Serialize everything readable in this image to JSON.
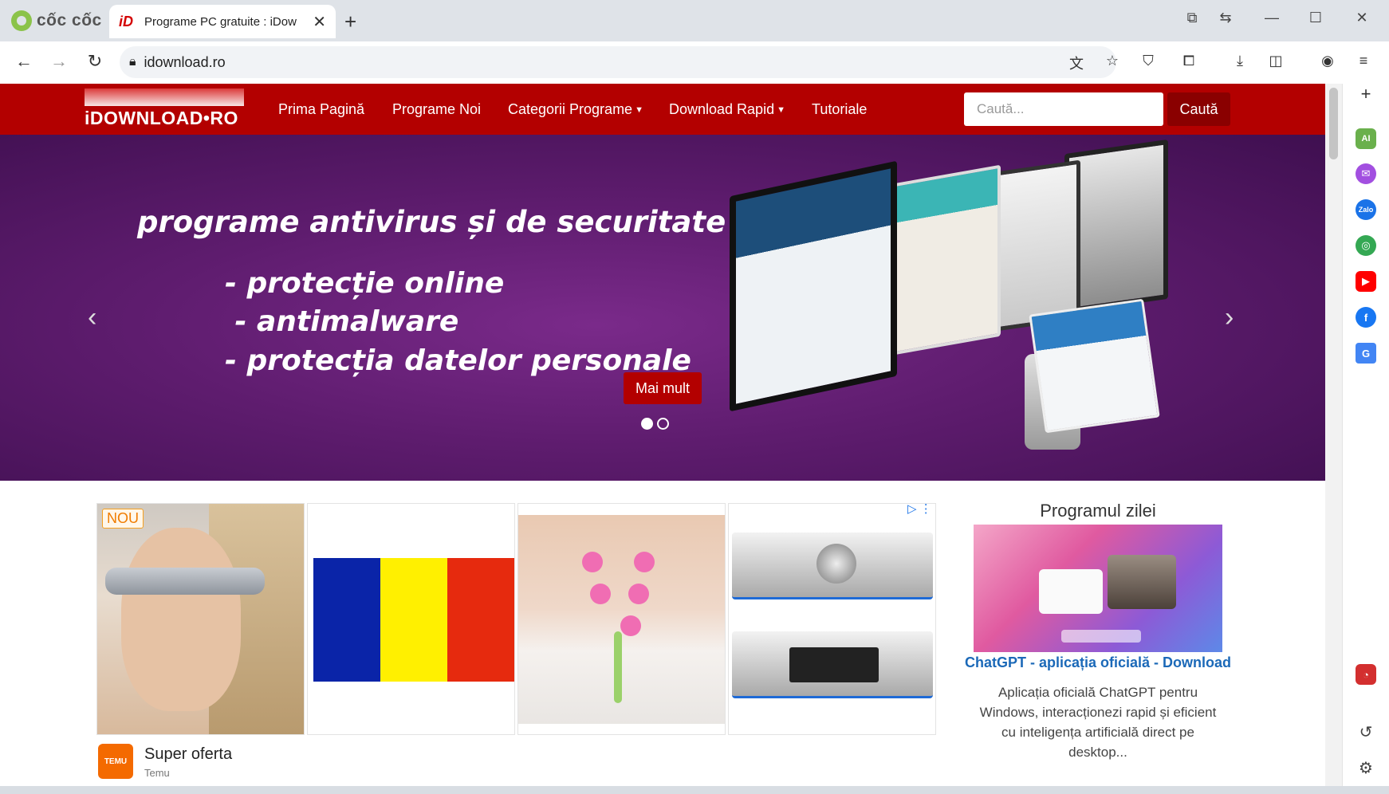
{
  "browser": {
    "brand": "cốc cốc",
    "tab_title": "Programe PC gratuite : iDow",
    "tab_favicon": "iD",
    "url": "idownload.ro",
    "accent": "#8bc34a"
  },
  "site": {
    "logo_text": "iDOWNLOAD•RO",
    "menu": {
      "home": "Prima Pagină",
      "new": "Programe Noi",
      "categories": "Categorii Programe",
      "rapid": "Download Rapid",
      "tutorials": "Tutoriale"
    },
    "search": {
      "placeholder": "Caută...",
      "button": "Caută"
    },
    "colors": {
      "header_red": "#b30000",
      "dark_red": "#8a0000",
      "link_blue": "#1b69b8"
    }
  },
  "hero": {
    "title": "programe antivirus și de securitate",
    "lines": [
      "- protecție online",
      " - antimalware",
      "- protecția datelor personale"
    ],
    "button": "Mai mult",
    "prev": "‹",
    "next": "›",
    "slide_count": 2,
    "active_slide": 1
  },
  "ads": {
    "badge": "NOU",
    "title": "Super oferta",
    "source": "Temu",
    "logo_text": "TEMU"
  },
  "potd": {
    "heading": "Programul zilei",
    "link": "ChatGPT - aplicația oficială - Download",
    "description": "Aplicația oficială ChatGPT pentru Windows, interacționezi rapid și eficient cu inteligența artificială direct pe desktop..."
  }
}
